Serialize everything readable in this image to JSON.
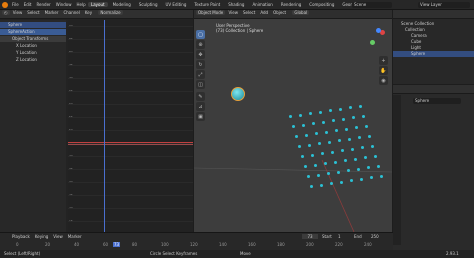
{
  "topbar": {
    "menus": [
      "File",
      "Edit",
      "Render",
      "Window",
      "Help"
    ],
    "workspaces": [
      "Layout",
      "Modeling",
      "Sculpting",
      "UV Editing",
      "Texture Paint",
      "Shading",
      "Animation",
      "Rendering",
      "Compositing",
      "Geometry Nodes"
    ],
    "active_workspace": "Layout",
    "scene": "Scene",
    "view_layer": "View Layer"
  },
  "left_tree": {
    "items": [
      "Sphere",
      "SphereAction",
      "Object Transforms",
      "X Location",
      "Y Location",
      "Z Location"
    ]
  },
  "graph": {
    "menus": [
      "View",
      "Select",
      "Marker",
      "Channel",
      "Key"
    ],
    "normalization": "Normalize",
    "numbers": [
      "90",
      "85",
      "80",
      "75",
      "70",
      "65",
      "60",
      "55",
      "50",
      "45",
      "40",
      "35",
      "30",
      "25",
      "20",
      "15"
    ],
    "playhead": "73"
  },
  "viewport": {
    "mode": "Object Mode",
    "menus": [
      "View",
      "Select",
      "Add",
      "Object"
    ],
    "transform": "Global",
    "perspective": "User Perspective",
    "collection": "(73) Collection | Sphere"
  },
  "outliner": {
    "title": "Scene Collection",
    "items": [
      {
        "label": "Collection"
      },
      {
        "label": "Camera"
      },
      {
        "label": "Cube"
      },
      {
        "label": "Light"
      },
      {
        "label": "Sphere"
      }
    ]
  },
  "properties": {
    "object_name": "Sphere"
  },
  "timeline": {
    "menus": [
      "Playback",
      "Keying",
      "View",
      "Marker"
    ],
    "current_frame": "73",
    "start_label": "Start",
    "start": "1",
    "end_label": "End",
    "end": "250",
    "ticks": [
      "0",
      "20",
      "40",
      "60",
      "80",
      "100",
      "120",
      "140",
      "160",
      "180",
      "200",
      "220",
      "240"
    ]
  },
  "status": {
    "left": "Select (Left/Right)",
    "mid": "Circle Select Keyframes",
    "right": "Move",
    "version": "2.93.1"
  },
  "colors": {
    "accent": "#4772b3",
    "sphere": "#2bc1d4",
    "playhead": "#4a6fcf"
  }
}
